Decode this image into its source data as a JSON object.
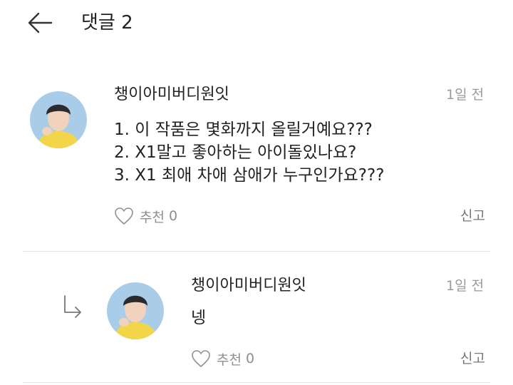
{
  "header": {
    "title": "댓글 2"
  },
  "comments": [
    {
      "author": "챙이아미버디원잇",
      "time": "1일 전",
      "lines": [
        "1. 이 작품은 몇화까지 올릴거예요???",
        "2. X1말고 좋아하는 아이돌있나요?",
        "3. X1 최애 차애 삼애가 누구인가요???"
      ],
      "like_label": "추천",
      "like_count": "0",
      "report_label": "신고"
    }
  ],
  "replies": [
    {
      "author": "챙이아미버디원잇",
      "time": "1일 전",
      "text": "넹",
      "like_label": "추천",
      "like_count": "0",
      "report_label": "신고"
    }
  ],
  "colors": {
    "text": "#222222",
    "muted": "#9a9a9a",
    "divider": "#e3e3e3",
    "avatar_bg": "#a9cde8",
    "avatar_shirt": "#f3d54a"
  }
}
